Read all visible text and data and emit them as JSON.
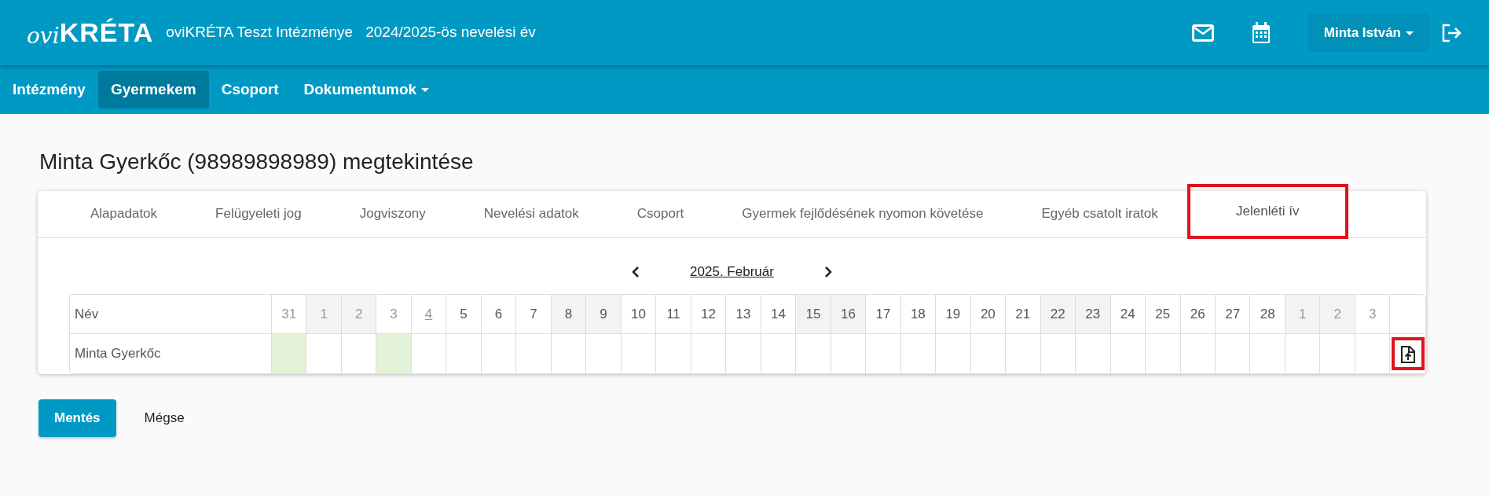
{
  "header": {
    "logo": {
      "prefix": "ovi",
      "brand": "KRÉTA"
    },
    "institution": "oviKRÉTA Teszt Intézménye",
    "school_year": "2024/2025-ös nevelési év",
    "user": "Minta István"
  },
  "nav": [
    {
      "label": "Intézmény",
      "selected": false,
      "dropdown": false
    },
    {
      "label": "Gyermekem",
      "selected": true,
      "dropdown": false
    },
    {
      "label": "Csoport",
      "selected": false,
      "dropdown": false
    },
    {
      "label": "Dokumentumok",
      "selected": false,
      "dropdown": true
    }
  ],
  "page_title": "Minta Gyerkőc (98989898989) megtekintése",
  "tabs": [
    {
      "label": "Alapadatok",
      "selected": false,
      "highlighted": false
    },
    {
      "label": "Felügyeleti jog",
      "selected": false,
      "highlighted": false
    },
    {
      "label": "Jogviszony",
      "selected": false,
      "highlighted": false
    },
    {
      "label": "Nevelési adatok",
      "selected": false,
      "highlighted": false
    },
    {
      "label": "Csoport",
      "selected": false,
      "highlighted": false
    },
    {
      "label": "Gyermek fejlődésének nyomon követése",
      "selected": false,
      "highlighted": false
    },
    {
      "label": "Egyéb csatolt iratok",
      "selected": false,
      "highlighted": false
    },
    {
      "label": "Jelenléti ív",
      "selected": true,
      "highlighted": true
    }
  ],
  "calendar": {
    "month": "2025. Február",
    "name_header": "Név",
    "days": [
      {
        "label": "31",
        "disabled": true,
        "weekend": false,
        "today": false
      },
      {
        "label": "1",
        "disabled": true,
        "weekend": true,
        "today": false
      },
      {
        "label": "2",
        "disabled": true,
        "weekend": true,
        "today": false
      },
      {
        "label": "3",
        "disabled": true,
        "weekend": false,
        "today": false
      },
      {
        "label": "4",
        "disabled": true,
        "weekend": false,
        "today": true
      },
      {
        "label": "5",
        "disabled": false,
        "weekend": false,
        "today": false
      },
      {
        "label": "6",
        "disabled": false,
        "weekend": false,
        "today": false
      },
      {
        "label": "7",
        "disabled": false,
        "weekend": false,
        "today": false
      },
      {
        "label": "8",
        "disabled": false,
        "weekend": true,
        "today": false
      },
      {
        "label": "9",
        "disabled": false,
        "weekend": true,
        "today": false
      },
      {
        "label": "10",
        "disabled": false,
        "weekend": false,
        "today": false
      },
      {
        "label": "11",
        "disabled": false,
        "weekend": false,
        "today": false
      },
      {
        "label": "12",
        "disabled": false,
        "weekend": false,
        "today": false
      },
      {
        "label": "13",
        "disabled": false,
        "weekend": false,
        "today": false
      },
      {
        "label": "14",
        "disabled": false,
        "weekend": false,
        "today": false
      },
      {
        "label": "15",
        "disabled": false,
        "weekend": true,
        "today": false
      },
      {
        "label": "16",
        "disabled": false,
        "weekend": true,
        "today": false
      },
      {
        "label": "17",
        "disabled": false,
        "weekend": false,
        "today": false
      },
      {
        "label": "18",
        "disabled": false,
        "weekend": false,
        "today": false
      },
      {
        "label": "19",
        "disabled": false,
        "weekend": false,
        "today": false
      },
      {
        "label": "20",
        "disabled": false,
        "weekend": false,
        "today": false
      },
      {
        "label": "21",
        "disabled": false,
        "weekend": false,
        "today": false
      },
      {
        "label": "22",
        "disabled": false,
        "weekend": true,
        "today": false
      },
      {
        "label": "23",
        "disabled": false,
        "weekend": true,
        "today": false
      },
      {
        "label": "24",
        "disabled": false,
        "weekend": false,
        "today": false
      },
      {
        "label": "25",
        "disabled": false,
        "weekend": false,
        "today": false
      },
      {
        "label": "26",
        "disabled": false,
        "weekend": false,
        "today": false
      },
      {
        "label": "27",
        "disabled": false,
        "weekend": false,
        "today": false
      },
      {
        "label": "28",
        "disabled": false,
        "weekend": false,
        "today": false
      },
      {
        "label": "1",
        "disabled": true,
        "weekend": true,
        "today": false
      },
      {
        "label": "2",
        "disabled": true,
        "weekend": true,
        "today": false
      },
      {
        "label": "3",
        "disabled": true,
        "weekend": false,
        "today": false
      }
    ],
    "rows": [
      {
        "name": "Minta Gyerkőc",
        "upload_highlighted": true,
        "cells": [
          {
            "marked": true
          },
          {
            "marked": false
          },
          {
            "marked": false
          },
          {
            "marked": true
          },
          {
            "marked": false
          },
          {
            "marked": false
          },
          {
            "marked": false
          },
          {
            "marked": false
          },
          {
            "marked": false
          },
          {
            "marked": false
          },
          {
            "marked": false
          },
          {
            "marked": false
          },
          {
            "marked": false
          },
          {
            "marked": false
          },
          {
            "marked": false
          },
          {
            "marked": false
          },
          {
            "marked": false
          },
          {
            "marked": false
          },
          {
            "marked": false
          },
          {
            "marked": false
          },
          {
            "marked": false
          },
          {
            "marked": false
          },
          {
            "marked": false
          },
          {
            "marked": false
          },
          {
            "marked": false
          },
          {
            "marked": false
          },
          {
            "marked": false
          },
          {
            "marked": false
          },
          {
            "marked": false
          },
          {
            "marked": false
          },
          {
            "marked": false
          },
          {
            "marked": false
          }
        ]
      }
    ]
  },
  "buttons": {
    "save": "Mentés",
    "cancel": "Mégse"
  }
}
